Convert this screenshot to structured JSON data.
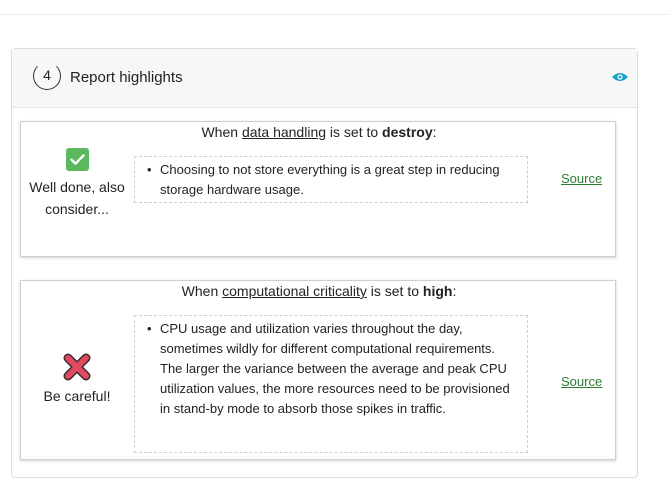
{
  "panel": {
    "step_number": "4",
    "title": "Report highlights",
    "toggle_icon": "eye-icon"
  },
  "highlights": [
    {
      "heading_prefix": "When ",
      "parameter": "data handling",
      "heading_middle": " is set to ",
      "value": "destroy",
      "heading_suffix": ":",
      "status_icon": "check-icon",
      "status_text": "Well done, also consider...",
      "status_color": "#5cb85c",
      "bullets": [
        "Choosing to not store everything is a great step in reducing storage hardware usage."
      ],
      "link_label": "Source"
    },
    {
      "heading_prefix": "When ",
      "parameter": "computational criticality",
      "heading_middle": " is set to ",
      "value": "high",
      "heading_suffix": ":",
      "status_icon": "cross-icon",
      "status_text": "Be careful!",
      "status_color": "#e04a5f",
      "bullets": [
        "CPU usage and utilization varies throughout the day, sometimes wildly for different computational requirements. The larger the variance between the average and peak CPU utilization values, the more resources need to be provisioned in stand-by mode to absorb those spikes in traffic."
      ],
      "link_label": "Source"
    }
  ],
  "colors": {
    "link": "#2e7d32",
    "accent_eye": "#1aa0c8"
  }
}
